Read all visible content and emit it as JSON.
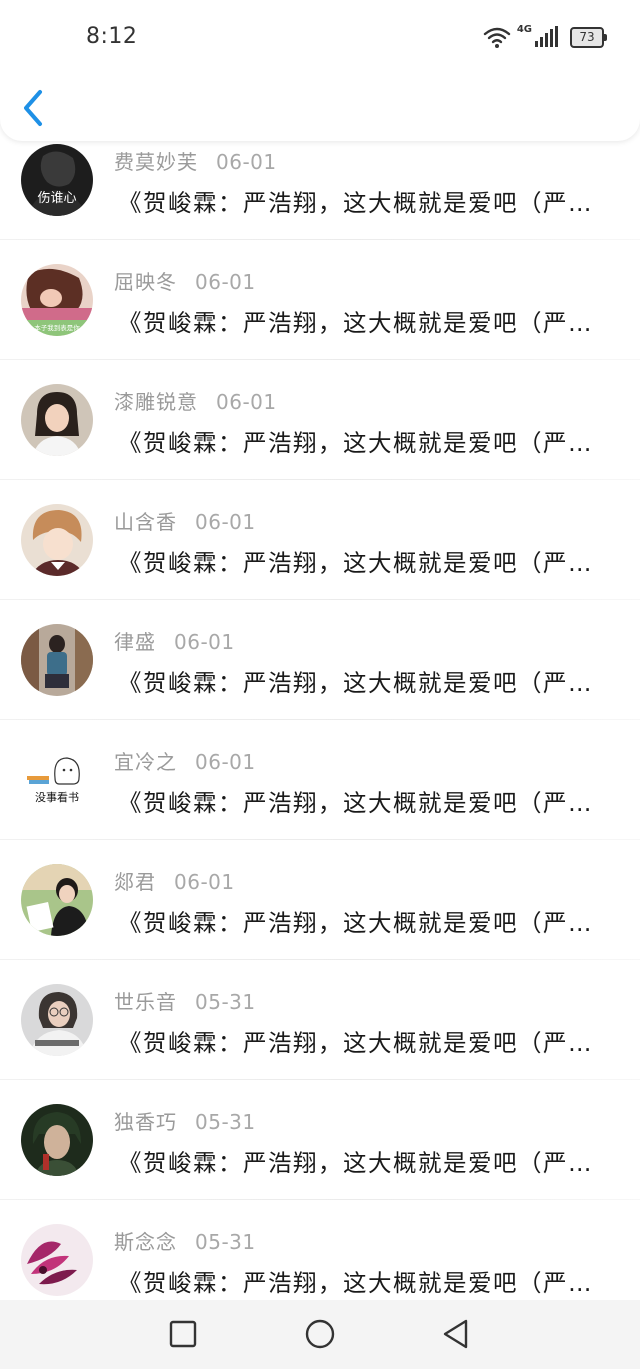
{
  "status_bar": {
    "time": "8:12",
    "network": "4G",
    "battery": "73",
    "icons": [
      "wifi-icon",
      "signal-icon",
      "battery-icon"
    ]
  },
  "header": {
    "back_icon": "chevron-left-icon",
    "accent_color": "#1e90e6"
  },
  "items": [
    {
      "name": "费莫妙芙",
      "date": "06-01",
      "message": "《贺峻霖：严浩翔，这大概就是爱吧（严浩翔x贺峻霖）》",
      "avatar": "avatar-text-heart"
    },
    {
      "name": "屈映冬",
      "date": "06-01",
      "message": "《贺峻霖：严浩翔，这大概就是爱吧（严浩翔x贺峻霖）》",
      "avatar": "avatar-girl-reading"
    },
    {
      "name": "漆雕锐意",
      "date": "06-01",
      "message": "《贺峻霖：严浩翔，这大概就是爱吧（严浩翔x贺峻霖）》",
      "avatar": "avatar-girl-smiling"
    },
    {
      "name": "山含香",
      "date": "06-01",
      "message": "《贺峻霖：严浩翔，这大概就是爱吧（严浩翔x贺峻霖）》",
      "avatar": "avatar-anime-boy"
    },
    {
      "name": "律盛",
      "date": "06-01",
      "message": "《贺峻霖：严浩翔，这大概就是爱吧（严浩翔x贺峻霖）》",
      "avatar": "avatar-girl-street"
    },
    {
      "name": "宜冷之",
      "date": "06-01",
      "message": "《贺峻霖：严浩翔，这大概就是爱吧（严浩翔x贺峻霖）》",
      "avatar": "avatar-cartoon-books"
    },
    {
      "name": "郯君",
      "date": "06-01",
      "message": "《贺峻霖：严浩翔，这大概就是爱吧（严浩翔x贺峻霖）》",
      "avatar": "avatar-boy-reading"
    },
    {
      "name": "世乐音",
      "date": "05-31",
      "message": "《贺峻霖：严浩翔，这大概就是爱吧（严浩翔x贺峻霖）》",
      "avatar": "avatar-girl-glasses"
    },
    {
      "name": "独香巧",
      "date": "05-31",
      "message": "《贺峻霖：严浩翔，这大概就是爱吧（严浩翔x贺峻霖）》",
      "avatar": "avatar-fantasy-man"
    },
    {
      "name": "斯念念",
      "date": "05-31",
      "message": "《贺峻霖：严浩翔，这大概就是爱吧（严浩翔x贺峻霖）》",
      "avatar": "avatar-pink-flower"
    }
  ],
  "avatar_text": {
    "item0": "伤谁心",
    "item1": "本子我到表是你",
    "item5": "没事看书"
  },
  "navbar": {
    "icons": [
      "square-recents-icon",
      "circle-home-icon",
      "triangle-back-icon"
    ]
  }
}
